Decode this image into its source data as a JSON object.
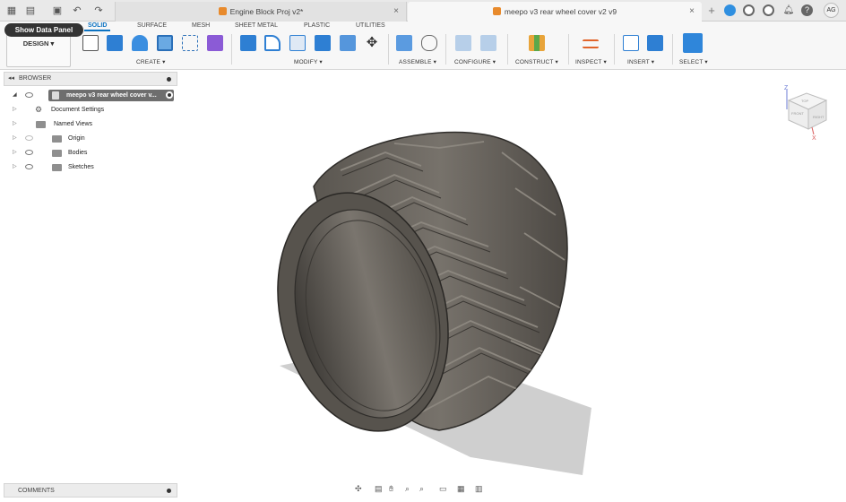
{
  "topbar": {
    "tabs": [
      {
        "title": "Engine Block Proj v2*",
        "active": false,
        "close": "×"
      },
      {
        "title": "meepo v3 rear wheel cover v2 v9",
        "active": true,
        "close": "×"
      }
    ],
    "user_initials": "AG"
  },
  "ribbon": {
    "workspace_label": "DESIGN ▾",
    "tooltip": "Show Data Panel",
    "tabs": [
      "SOLID",
      "SURFACE",
      "MESH",
      "SHEET METAL",
      "PLASTIC",
      "UTILITIES"
    ],
    "active_tab": "SOLID",
    "groups": [
      "CREATE ▾",
      "MODIFY ▾",
      "ASSEMBLE ▾",
      "CONFIGURE ▾",
      "CONSTRUCT ▾",
      "INSPECT ▾",
      "INSERT ▾",
      "SELECT ▾"
    ]
  },
  "browser": {
    "title": "BROWSER",
    "root_item": "meepo v3 rear wheel cover v...",
    "items": [
      {
        "label": "Document Settings",
        "icon": "gear-icon"
      },
      {
        "label": "Named Views",
        "icon": "folder-icon"
      },
      {
        "label": "Origin",
        "icon": "folder-icon"
      },
      {
        "label": "Bodies",
        "icon": "folder-icon"
      },
      {
        "label": "Sketches",
        "icon": "folder-icon"
      }
    ]
  },
  "viewcube": {
    "z_label": "Z",
    "x_label": "X",
    "top_label": "TOP",
    "front_label": "FRONT",
    "right_label": "RIGHT"
  },
  "comments": {
    "title": "COMMENTS"
  },
  "colors": {
    "accent": "#0c73c2",
    "tab_orange": "#e88a2c",
    "model_gray": "#5f5b55"
  }
}
